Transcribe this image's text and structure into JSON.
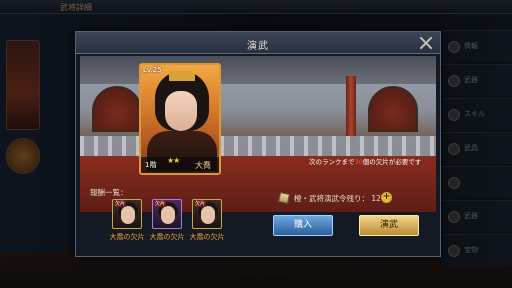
{
  "background": {
    "top_title": "武将詳細",
    "side_menu": [
      "情報",
      "武器",
      "スキル",
      "武具",
      "",
      "武器",
      "宝物"
    ]
  },
  "modal": {
    "title": "演武"
  },
  "character": {
    "level": "Lv.25",
    "floor": "1階",
    "stars": "★★",
    "name": "大喬"
  },
  "rank_note": {
    "before": "次のランクまで",
    "count": "30",
    "after": "個の欠片が必要です"
  },
  "rewards": {
    "title": "報酬一覧：",
    "items": [
      {
        "tag": "欠片",
        "label": "大喬の欠片"
      },
      {
        "tag": "欠片",
        "label": "大喬の欠片"
      },
      {
        "tag": "欠片",
        "label": "大喬の欠片"
      }
    ]
  },
  "token": {
    "text": "橙・武将演武令残り： 12"
  },
  "buttons": {
    "buy": "購入",
    "train": "演武"
  },
  "colors": {
    "accent_gold": "#d89a34",
    "reward_label": "#f0a43a",
    "buy_blue": "#2c5e9a",
    "highlight_red": "#ff4a3a"
  }
}
